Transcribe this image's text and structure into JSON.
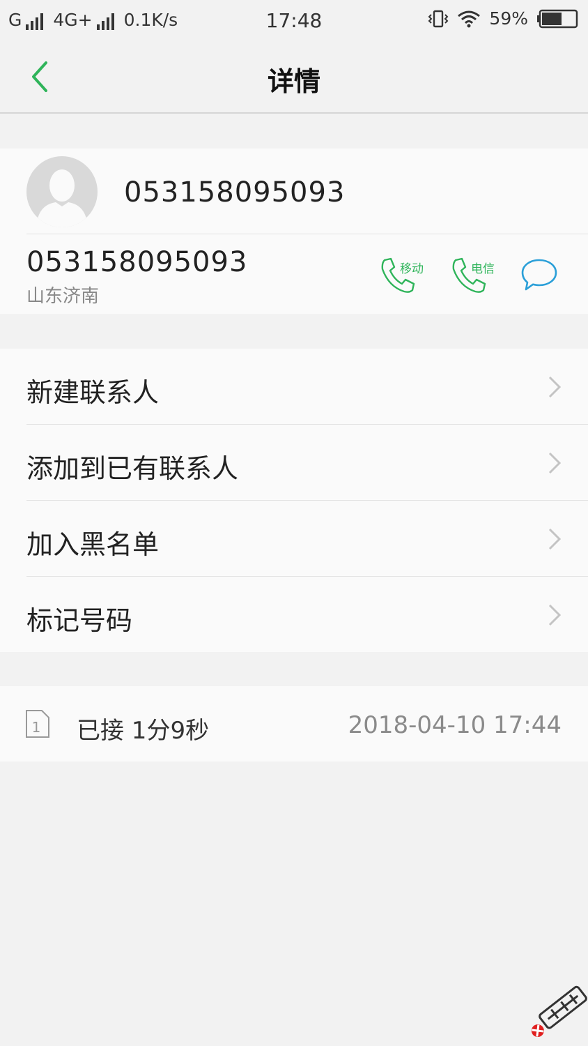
{
  "status_bar": {
    "sim1_label": "G",
    "sim2_label": "4G+",
    "net_speed": "0.1K/s",
    "time": "17:48",
    "battery_percent": "59%",
    "battery_level": 0.59
  },
  "header": {
    "title": "详情",
    "back_icon": "chevron-left-icon"
  },
  "contact": {
    "name": "053158095093",
    "number": "053158095093",
    "location": "山东济南",
    "actions": [
      {
        "icon": "phone-icon",
        "label": "移动"
      },
      {
        "icon": "phone-icon",
        "label": "电信"
      },
      {
        "icon": "message-icon",
        "label": ""
      }
    ]
  },
  "menu": {
    "items": [
      {
        "label": "新建联系人"
      },
      {
        "label": "添加到已有联系人"
      },
      {
        "label": "加入黑名单"
      },
      {
        "label": "标记号码"
      }
    ]
  },
  "call_record": {
    "sim_slot": "1",
    "status": "已接 1分9秒",
    "datetime": "2018-04-10 17:44"
  },
  "colors": {
    "accent_green": "#2fb45a",
    "message_blue": "#2a9fd8",
    "background": "#f2f2f2",
    "card": "#fafafa"
  }
}
